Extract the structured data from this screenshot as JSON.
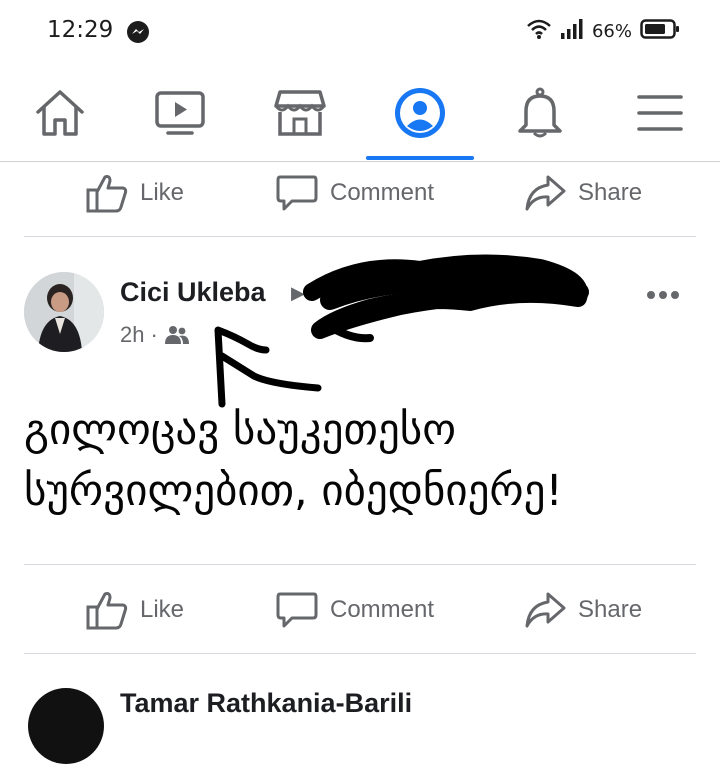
{
  "status_bar": {
    "time": "12:29",
    "battery": "66%"
  },
  "nav": {
    "tabs": [
      "home-icon",
      "watch-icon",
      "marketplace-icon",
      "profile-icon",
      "notifications-icon",
      "menu-icon"
    ],
    "active_tab": "profile-icon",
    "accent_color": "#1877f2"
  },
  "actions": {
    "like": "Like",
    "comment": "Comment",
    "share": "Share"
  },
  "post": {
    "author": "Cici Ukleba",
    "time": "2h",
    "separator": "·",
    "audience_icon": "friends-icon",
    "text_line1": "გილოცავ საუკეთესო",
    "text_line2": "სურვილებით, იბედნიერე!"
  },
  "next_post": {
    "author": "Tamar Rathkania-Barili"
  }
}
